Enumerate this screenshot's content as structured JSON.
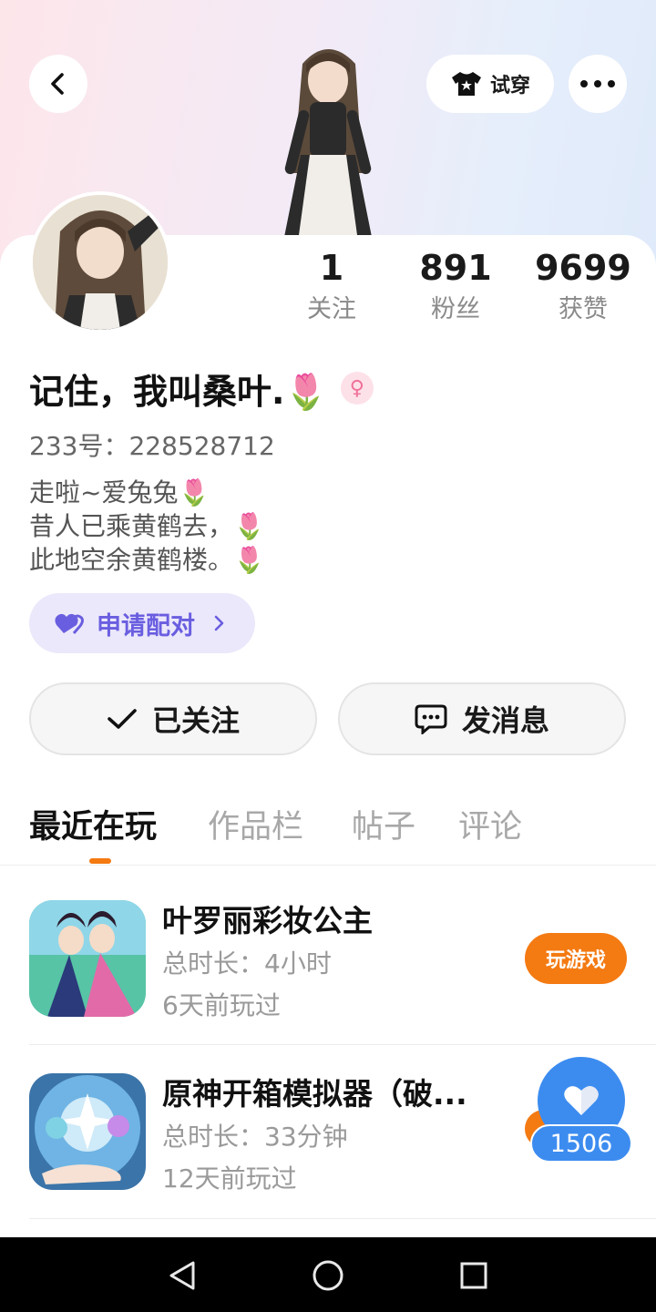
{
  "header": {
    "tryon_label": "试穿",
    "back_icon": "chevron-left-icon",
    "more_icon": "more-dots-icon",
    "tryon_icon": "shirt-icon"
  },
  "profile": {
    "name": "记住，我叫桑叶.🌷",
    "gender_icon": "female-icon",
    "uid": "233号：228528712",
    "bio": [
      "走啦~爱兔兔🌷",
      "昔人已乘黄鹤去，🌷",
      "此地空余黄鹤楼。🌷"
    ]
  },
  "stats": [
    {
      "value": "1",
      "label": "关注"
    },
    {
      "value": "891",
      "label": "粉丝"
    },
    {
      "value": "9699",
      "label": "获赞"
    }
  ],
  "pair_button": {
    "label": "申请配对",
    "icon": "heart-pair-icon",
    "accent": "#6a5ee0"
  },
  "actions": {
    "followed": "已关注",
    "message": "发消息"
  },
  "tabs": [
    {
      "label": "最近在玩",
      "active": true
    },
    {
      "label": "作品栏",
      "active": false
    },
    {
      "label": "帖子",
      "active": false
    },
    {
      "label": "评论",
      "active": false
    }
  ],
  "games": [
    {
      "title": "叶罗丽彩妆公主",
      "duration": "总时长：4小时",
      "last_played": "6天前玩过",
      "button": "玩游戏"
    },
    {
      "title": "原神开箱模拟器（破...",
      "duration": "总时长：33分钟",
      "last_played": "12天前玩过"
    }
  ],
  "like_fab": {
    "count": "1506",
    "icon": "heart-icon"
  },
  "colors": {
    "accent": "#f47a12",
    "like_blue": "#3c8cf0",
    "pair_purple": "#ebe8fb"
  }
}
